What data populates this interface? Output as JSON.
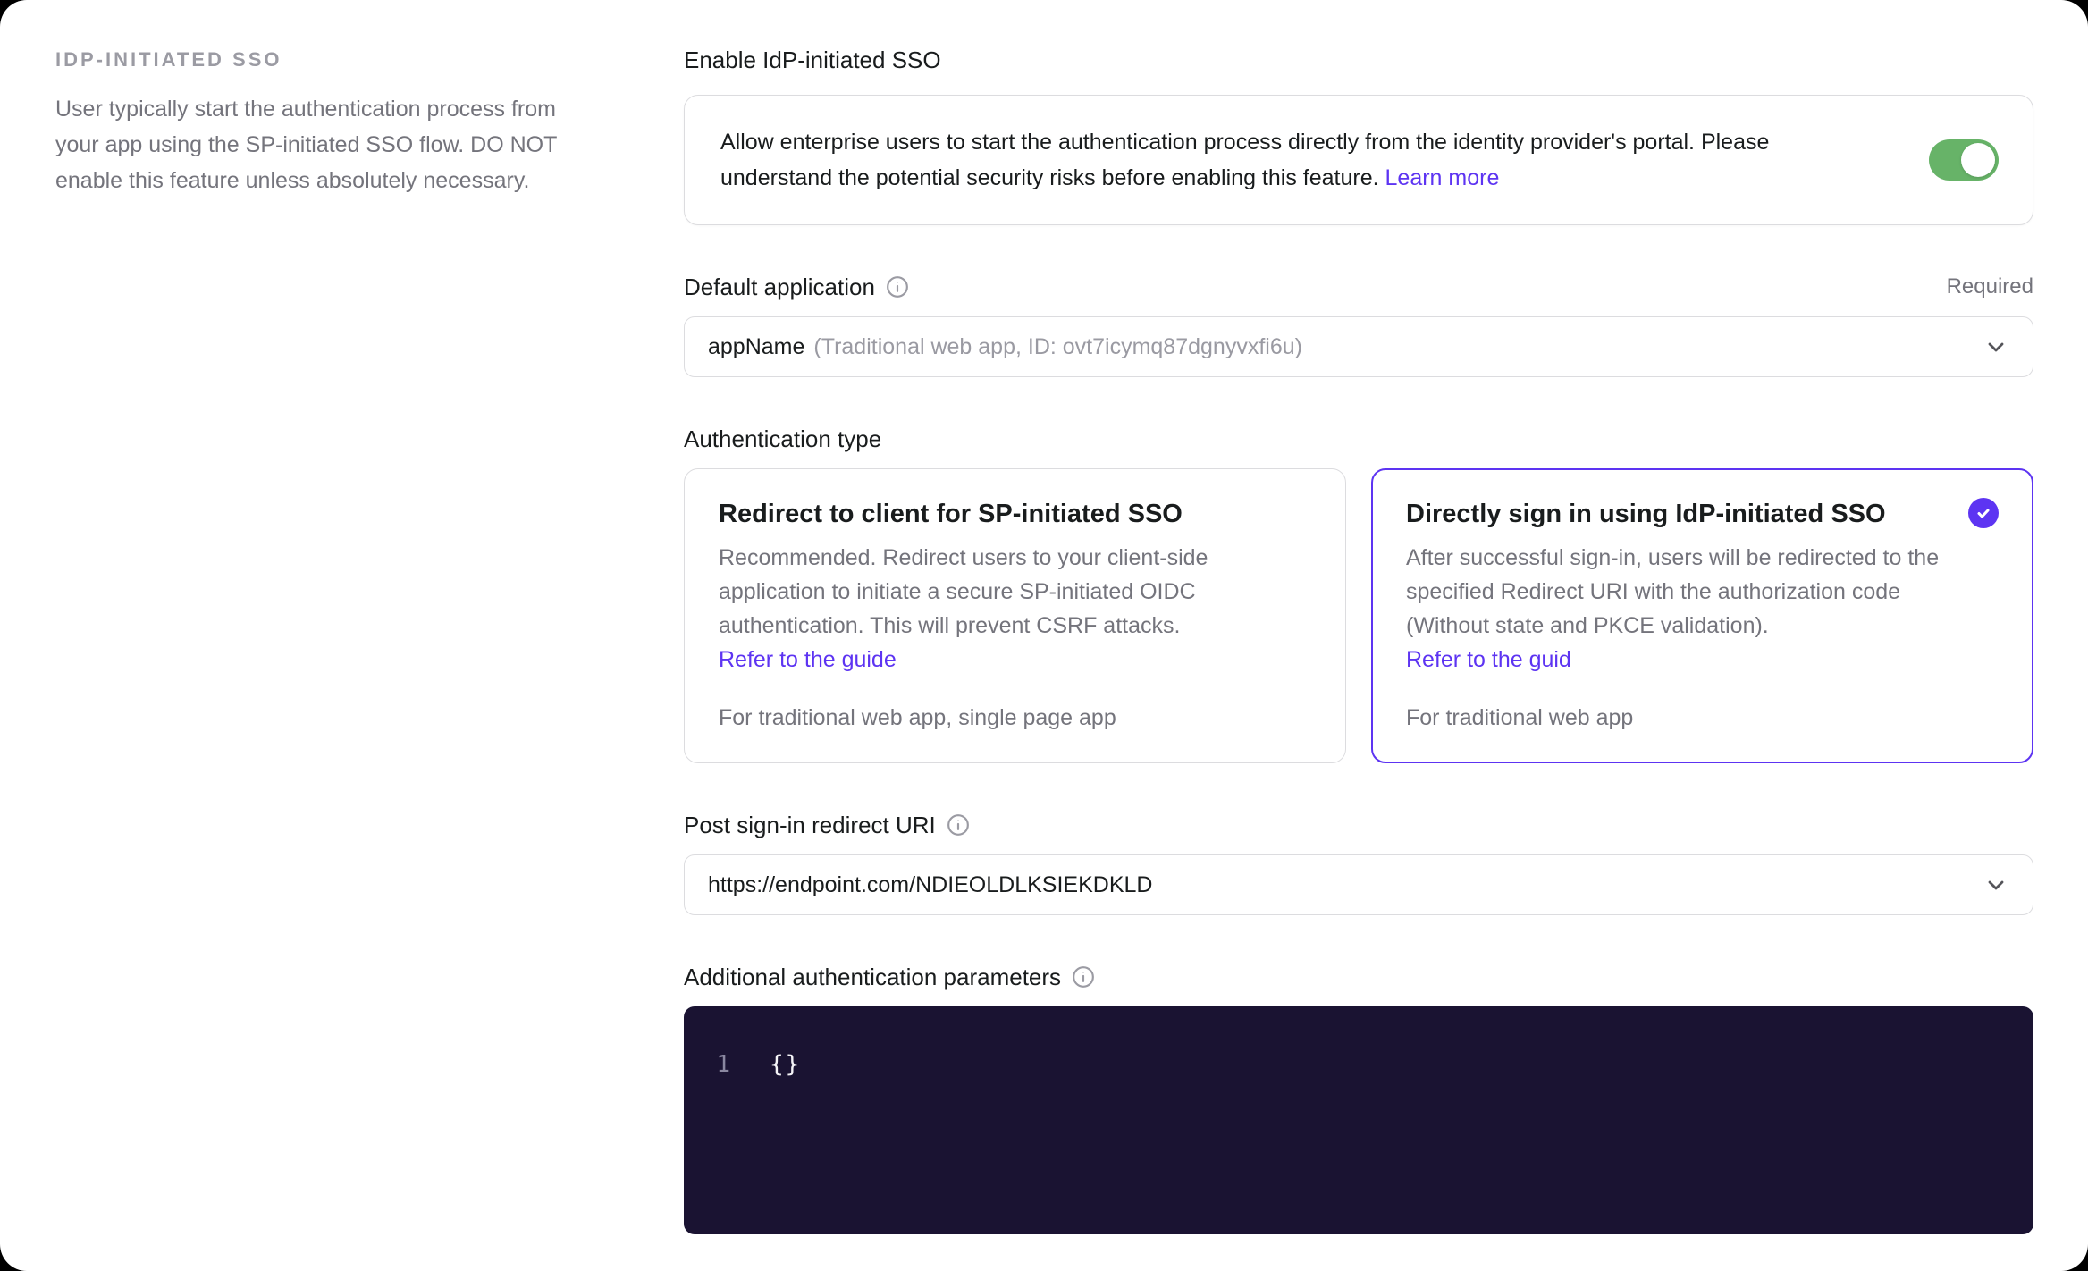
{
  "colors": {
    "accent": "#5d34f2",
    "toggle_on": "#67b368",
    "editor_bg": "#1a1332"
  },
  "sidebar": {
    "heading": "IDP-INITIATED SSO",
    "description": "User typically start the authentication process from your app using the SP-initiated SSO flow. DO NOT enable this feature unless absolutely necessary."
  },
  "enable": {
    "label": "Enable IdP-initiated SSO",
    "description": "Allow enterprise users to start the authentication process directly from the identity provider's portal. Please understand the potential security risks before enabling this feature.",
    "learn_more": "Learn more",
    "toggle_state": "on"
  },
  "default_application": {
    "label": "Default application",
    "required_badge": "Required",
    "value_primary": "appName",
    "value_secondary": "(Traditional web app, ID: ovt7icymq87dgnyvxfi6u)"
  },
  "authentication_type": {
    "label": "Authentication type",
    "options": [
      {
        "title": "Redirect to client for SP-initiated SSO",
        "description": "Recommended. Redirect users to your client-side application to initiate a secure SP-initiated OIDC authentication. This will prevent CSRF attacks.",
        "link": "Refer to the guide",
        "footnote": "For traditional web app, single page app",
        "selected": false
      },
      {
        "title": "Directly sign in using IdP-initiated SSO",
        "description": "After successful sign-in, users will be redirected to the specified Redirect URI with the authorization code (Without state and PKCE validation).",
        "link": "Refer to the guid",
        "footnote": "For traditional web app",
        "selected": true
      }
    ]
  },
  "redirect_uri": {
    "label": "Post sign-in redirect URI",
    "value": "https://endpoint.com/NDIEOLDLKSIEKDKLD"
  },
  "additional_params": {
    "label": "Additional authentication parameters",
    "line_number": "1",
    "code": "{}"
  }
}
